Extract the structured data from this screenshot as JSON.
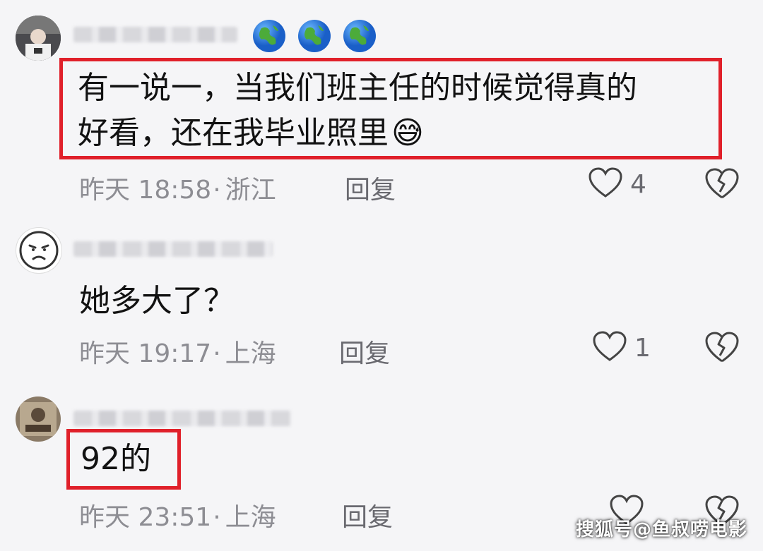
{
  "comments": [
    {
      "username_redacted": true,
      "badges": [
        "globe-icon",
        "globe-icon",
        "globe-icon"
      ],
      "text_line1": "有一说一，当我们班主任的时候觉得真的",
      "text_line2": "好看，还在我毕业照里",
      "emoji": "😅",
      "date": "昨天",
      "time": "18:58",
      "location": "浙江",
      "reply_label": "回复",
      "like_count": "4"
    },
    {
      "username_redacted": true,
      "text_line1": "她多大了？",
      "date": "昨天",
      "time": "19:17",
      "location": "上海",
      "reply_label": "回复",
      "like_count": "1"
    },
    {
      "username_redacted": true,
      "text_line1": "92的",
      "date": "昨天",
      "time": "23:51",
      "location": "上海",
      "reply_label": "回复",
      "like_count": ""
    }
  ],
  "watermark": "搜狐号@鱼叔唠电影",
  "colors": {
    "highlight_box": "#e0202a",
    "meta_text": "#8d8d93",
    "background": "#f5f5f7"
  }
}
